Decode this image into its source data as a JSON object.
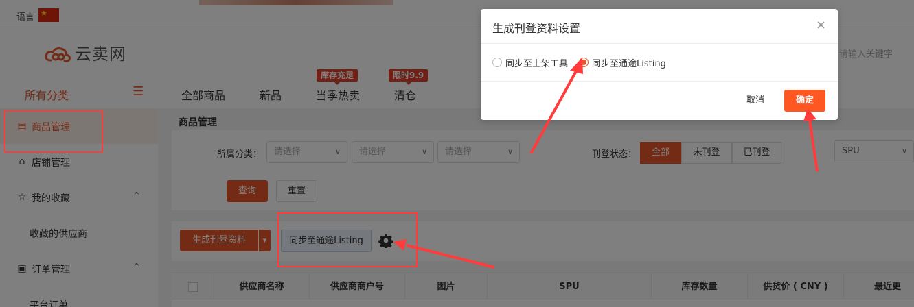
{
  "topbar": {
    "language_label": "语言",
    "flag_glyph": "★"
  },
  "header": {
    "logo_text": "云卖网",
    "search_placeholder": "请输入关键字",
    "all_categories": "所有分类",
    "nav": [
      "全部商品",
      "新品",
      "当季热卖",
      "清仓"
    ],
    "badges": {
      "hot": "库存充足",
      "clearance": "限时9.9"
    }
  },
  "sidebar": {
    "items": [
      {
        "label": "商品管理",
        "icon": "clipboard-icon"
      },
      {
        "label": "店铺管理",
        "icon": "store-icon"
      },
      {
        "label": "我的收藏",
        "icon": "star-icon",
        "chevron": "^"
      },
      {
        "label": "收藏的供应商"
      },
      {
        "label": "订单管理",
        "icon": "list-icon",
        "chevron": "^"
      },
      {
        "label": "平台订单"
      }
    ]
  },
  "main": {
    "title": "商品管理",
    "filter": {
      "category_label": "所属分类：",
      "select_placeholder": "请选择",
      "status_label": "刊登状态：",
      "status_options": [
        "全部",
        "未刊登",
        "已刊登"
      ],
      "spu_select": "SPU",
      "query_button": "查询",
      "reset_button": "重置"
    },
    "actions": {
      "generate_button": "生成刊登资料",
      "dropdown_glyph": "▾",
      "sync_button": "同步至通途Listing"
    },
    "table": {
      "headers": [
        "供应商名称",
        "供应商商户号",
        "图片",
        "SPU",
        "库存数量",
        "供货价 ( CNY )",
        "最近更"
      ]
    }
  },
  "dialog": {
    "title": "生成刊登资料设置",
    "close_glyph": "×",
    "options": [
      "同步至上架工具",
      "同步至通途Listing"
    ],
    "selected_index": 1,
    "cancel": "取消",
    "confirm": "确定"
  },
  "colors": {
    "accent": "#e8572a",
    "confirm": "#ff5722",
    "annotation": "#ff3b3b"
  }
}
